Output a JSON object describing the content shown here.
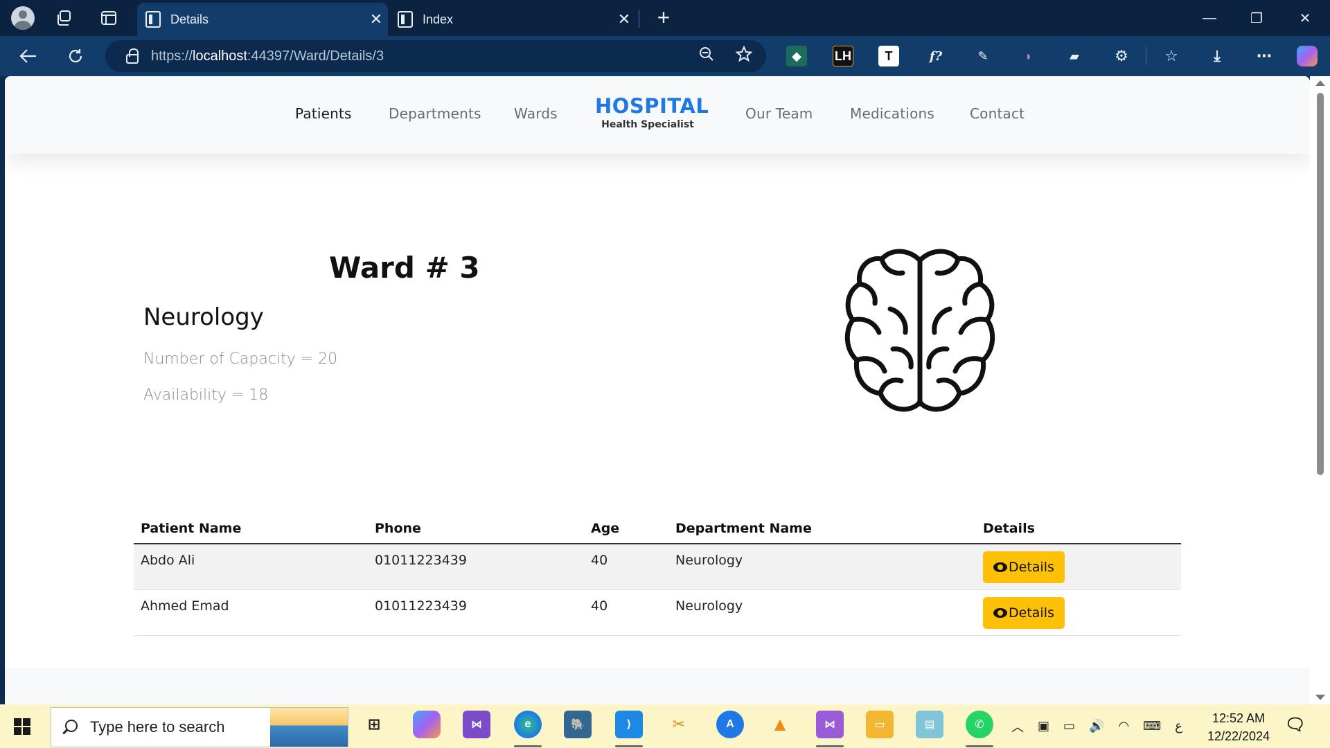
{
  "browser": {
    "tabs": [
      {
        "title": "Details",
        "active": true
      },
      {
        "title": "Index",
        "active": false
      }
    ],
    "new_tab": "+",
    "url_scheme": "https://",
    "url_host": "localhost",
    "url_path": ":44397/Ward/Details/3",
    "window_controls": {
      "minimize": "—",
      "restore": "❐",
      "close": "✕"
    },
    "extensions": [
      "LH",
      "T",
      "f?"
    ]
  },
  "site": {
    "nav_left": [
      "Patients",
      "Departments",
      "Wards"
    ],
    "brand_title": "HOSPITAL",
    "brand_sub": "Health Specialist",
    "nav_right": [
      "Our Team",
      "Medications",
      "Contact"
    ]
  },
  "ward": {
    "title": "Ward # 3",
    "department": "Neurology",
    "capacity_text": "Number of Capacity = 20",
    "availability_text": "Availability = 18"
  },
  "table": {
    "headers": [
      "Patient Name",
      "Phone",
      "Age",
      "Department Name",
      "Details"
    ],
    "rows": [
      {
        "name": "Abdo Ali",
        "phone": "01011223439",
        "age": "40",
        "department": "Neurology",
        "button": "Details"
      },
      {
        "name": "Ahmed Emad",
        "phone": "01011223439",
        "age": "40",
        "department": "Neurology",
        "button": "Details"
      }
    ]
  },
  "taskbar": {
    "search_placeholder": "Type here to search",
    "time": "12:52 AM",
    "date": "12/22/2024",
    "lang": "ع"
  },
  "colors": {
    "brand": "#1e78e6",
    "details_button": "#ffc107",
    "browser_frame": "#0b2240",
    "toolbar": "#123d6b"
  }
}
